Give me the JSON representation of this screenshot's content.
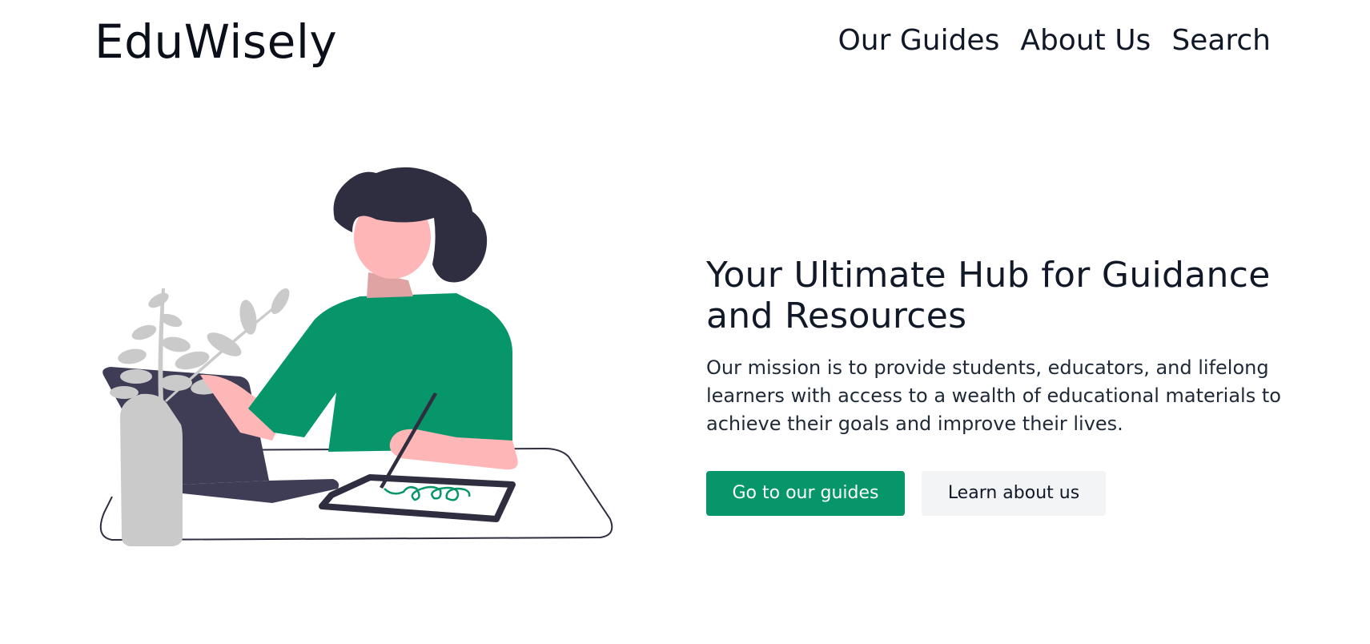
{
  "header": {
    "logo": "EduWisely",
    "nav": [
      {
        "label": "Our Guides"
      },
      {
        "label": "About Us"
      },
      {
        "label": "Search"
      }
    ]
  },
  "hero": {
    "title": "Your Ultimate Hub for Guidance and Resources",
    "description": "Our mission is to provide students, educators, and lifelong learners with access to a wealth of educational materials to achieve their goals and improve their lives.",
    "primary_button": "Go to our guides",
    "secondary_button": "Learn about us"
  },
  "illustration": {
    "icon": "person-at-desk-illustration",
    "colors": {
      "shirt": "#069669",
      "hair": "#2f2e41",
      "skin": "#ffb6b6",
      "laptop": "#3f3d56",
      "plant": "#cacaca"
    }
  },
  "colors": {
    "accent": "#079669",
    "secondary_bg": "#f3f4f6",
    "text": "#111827"
  }
}
